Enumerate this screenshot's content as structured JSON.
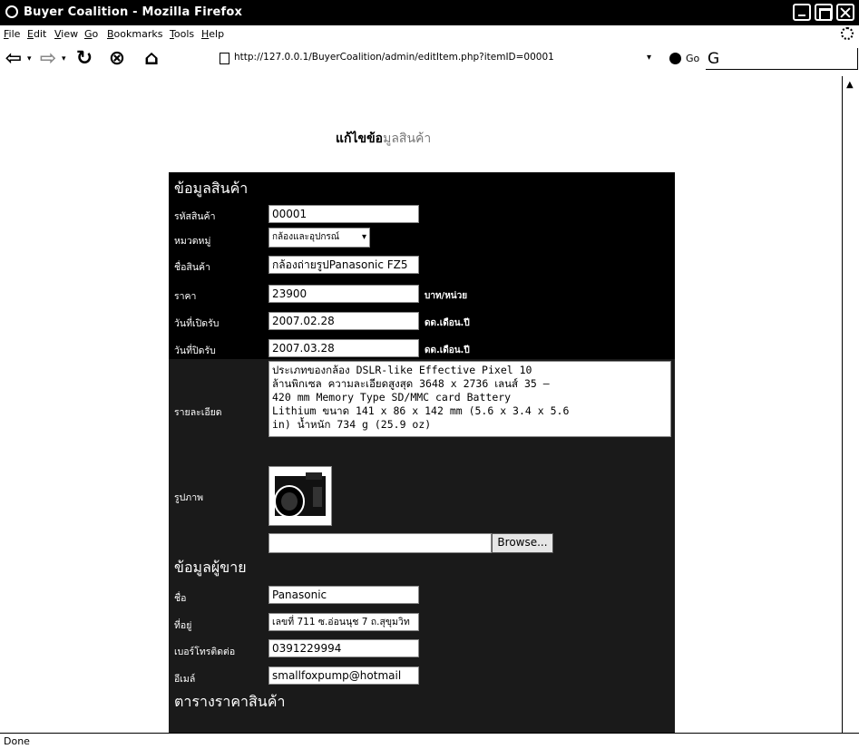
{
  "window": {
    "title": "Buyer Coalition - Mozilla Firefox"
  },
  "menu": [
    "File",
    "Edit",
    "View",
    "Go",
    "Bookmarks",
    "Tools",
    "Help"
  ],
  "navbar": {
    "url": "http://127.0.0.1/BuyerCoalition/admin/editItem.php?itemID=00001",
    "go_label": "Go",
    "search_glyph": "G"
  },
  "page": {
    "heading_bold": "แก้ไขข้อ",
    "heading_faded": "มูลสินค้า"
  },
  "product": {
    "section_title": "ข้อมูลสินค้า",
    "id_label": "รหัสสินค้า",
    "id_value": "00001",
    "category_label": "หมวดหมู่",
    "category_value": "กล้องและอุปกรณ์",
    "name_label": "ชื่อสินค้า",
    "name_value": "กล้องถ่ายรูปPanasonic FZ5",
    "price_label": "ราคา",
    "price_value": "23900",
    "price_unit": "บาท/หน่วย",
    "open_label": "วันที่เปิดรับ",
    "open_value": "2007.02.28",
    "open_unit": "ดด.เดือน.ปี",
    "close_label": "วันที่ปิดรับ",
    "close_value": "2007.03.28",
    "close_unit": "ดด.เดือน.ปี",
    "detail_label": "รายละเอียด",
    "detail_lines": [
      "ประเภทของกล้อง DSLR-like  Effective Pixel 10",
      "ล้านพิกเซล  ความละเอียดสูงสุด 3648 x 2736  เลนส์ 35 –",
      "420 mm  Memory Type SD/MMC card  Battery",
      "Lithium  ขนาด 141 x 86 x 142 mm (5.6 x 3.4 x 5.6",
      "in)  น้ำหนัก 734 g (25.9 oz)"
    ],
    "image_label": "รูปภาพ",
    "browse_label": "Browse..."
  },
  "seller": {
    "section_title": "ข้อมูลผู้ขาย",
    "name_label": "ชื่อ",
    "name_value": "Panasonic",
    "address_label": "ที่อยู่",
    "address_value": "เลขที่ 711 ซ.อ่อนนุช 7 ถ.สุขุมวิท",
    "phone_label": "เบอร์โทรติดต่อ",
    "phone_value": "0391229994",
    "email_label": "อีเมล์",
    "email_value": "smallfoxpump@hotmail"
  },
  "price_table": {
    "section_title": "ตารางราคาสินค้า"
  },
  "status": {
    "text": "Done"
  },
  "colors": {
    "form_bg": "#000000",
    "lower_form_bg": "#1a1a1a",
    "titlebar": "#000000"
  }
}
